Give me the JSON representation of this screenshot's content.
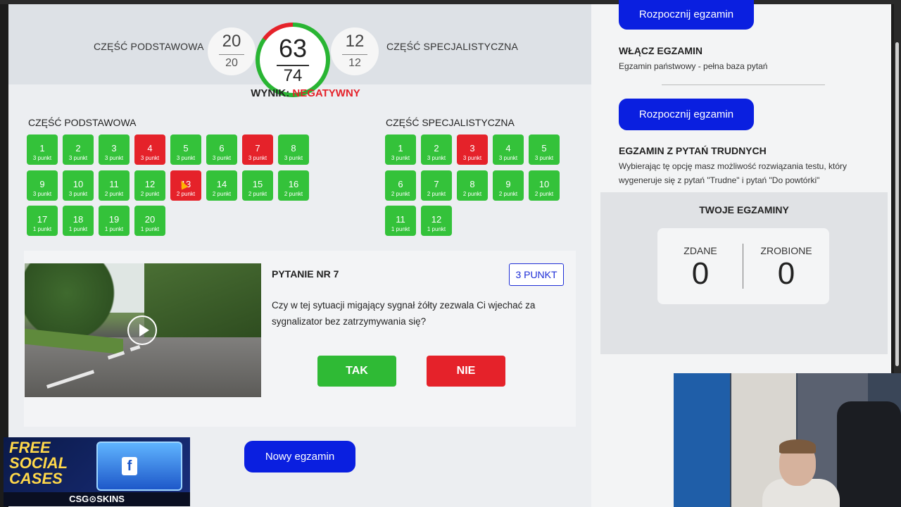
{
  "header": {
    "basic_label": "CZĘŚĆ PODSTAWOWA",
    "spec_label": "CZĘŚĆ SPECJALISTYCZNA",
    "basic_score": {
      "got": "20",
      "total": "20"
    },
    "spec_score": {
      "got": "12",
      "total": "12"
    },
    "total_score": {
      "got": "63",
      "total": "74"
    },
    "result_label": "WYNIK:",
    "result_value": "NEGATYWNY"
  },
  "basic_section": {
    "title": "CZĘŚĆ PODSTAWOWA",
    "questions": [
      {
        "n": "1",
        "pts": "3 punkt",
        "status": "correct"
      },
      {
        "n": "2",
        "pts": "3 punkt",
        "status": "correct"
      },
      {
        "n": "3",
        "pts": "3 punkt",
        "status": "correct"
      },
      {
        "n": "4",
        "pts": "3 punkt",
        "status": "wrong"
      },
      {
        "n": "5",
        "pts": "3 punkt",
        "status": "correct"
      },
      {
        "n": "6",
        "pts": "3 punkt",
        "status": "correct"
      },
      {
        "n": "7",
        "pts": "3 punkt",
        "status": "wrong"
      },
      {
        "n": "8",
        "pts": "3 punkt",
        "status": "correct"
      },
      {
        "n": "9",
        "pts": "3 punkt",
        "status": "correct"
      },
      {
        "n": "10",
        "pts": "3 punkt",
        "status": "correct"
      },
      {
        "n": "11",
        "pts": "2 punkt",
        "status": "correct"
      },
      {
        "n": "12",
        "pts": "2 punkt",
        "status": "correct"
      },
      {
        "n": "13",
        "pts": "2 punkt",
        "status": "wrong"
      },
      {
        "n": "14",
        "pts": "2 punkt",
        "status": "correct"
      },
      {
        "n": "15",
        "pts": "2 punkt",
        "status": "correct"
      },
      {
        "n": "16",
        "pts": "2 punkt",
        "status": "correct"
      },
      {
        "n": "17",
        "pts": "1 punkt",
        "status": "correct"
      },
      {
        "n": "18",
        "pts": "1 punkt",
        "status": "correct"
      },
      {
        "n": "19",
        "pts": "1 punkt",
        "status": "correct"
      },
      {
        "n": "20",
        "pts": "1 punkt",
        "status": "correct"
      }
    ]
  },
  "spec_section": {
    "title": "CZĘŚĆ SPECJALISTYCZNA",
    "questions": [
      {
        "n": "1",
        "pts": "3 punkt",
        "status": "correct"
      },
      {
        "n": "2",
        "pts": "3 punkt",
        "status": "correct"
      },
      {
        "n": "3",
        "pts": "3 punkt",
        "status": "wrong"
      },
      {
        "n": "4",
        "pts": "3 punkt",
        "status": "correct"
      },
      {
        "n": "5",
        "pts": "3 punkt",
        "status": "correct"
      },
      {
        "n": "6",
        "pts": "2 punkt",
        "status": "correct"
      },
      {
        "n": "7",
        "pts": "2 punkt",
        "status": "correct"
      },
      {
        "n": "8",
        "pts": "2 punkt",
        "status": "correct"
      },
      {
        "n": "9",
        "pts": "2 punkt",
        "status": "correct"
      },
      {
        "n": "10",
        "pts": "2 punkt",
        "status": "correct"
      },
      {
        "n": "11",
        "pts": "1 punkt",
        "status": "correct"
      },
      {
        "n": "12",
        "pts": "1 punkt",
        "status": "correct"
      }
    ]
  },
  "question": {
    "title": "PYTANIE NR 7",
    "points": "3 PUNKT",
    "text": "Czy w tej sytuacji migający sygnał żółty zezwala Ci wjechać za sygnalizator bez zatrzymywania się?",
    "yes_label": "TAK",
    "no_label": "NIE"
  },
  "new_exam_label": "Nowy egzamin",
  "sidebar": {
    "start_button_1": "Rozpocznij egzamin",
    "enable_title": "WŁĄCZ EGZAMIN",
    "enable_sub": "Egzamin państwowy - pełna baza pytań",
    "start_button_2": "Rozpocznij egzamin",
    "hard_title": "EGZAMIN Z PYTAŃ TRUDNYCH",
    "hard_sub": "Wybierając tę opcję masz możliwość rozwiązania testu, który wygeneruje się z pytań \"Trudne\" i pytań \"Do powtórki\"",
    "my_exams_title": "TWOJE EGZAMINY",
    "passed_label": "ZDANE",
    "passed_value": "0",
    "done_label": "ZROBIONE",
    "done_value": "0"
  },
  "promo": {
    "line1": "FREE",
    "line2": "SOCIAL",
    "line3": "CASES",
    "brand": "CSG⊙SKINS",
    "chest_icon": "f"
  },
  "colors": {
    "correct": "#34c23a",
    "wrong": "#e5222a",
    "accent": "#0a1fe0"
  }
}
